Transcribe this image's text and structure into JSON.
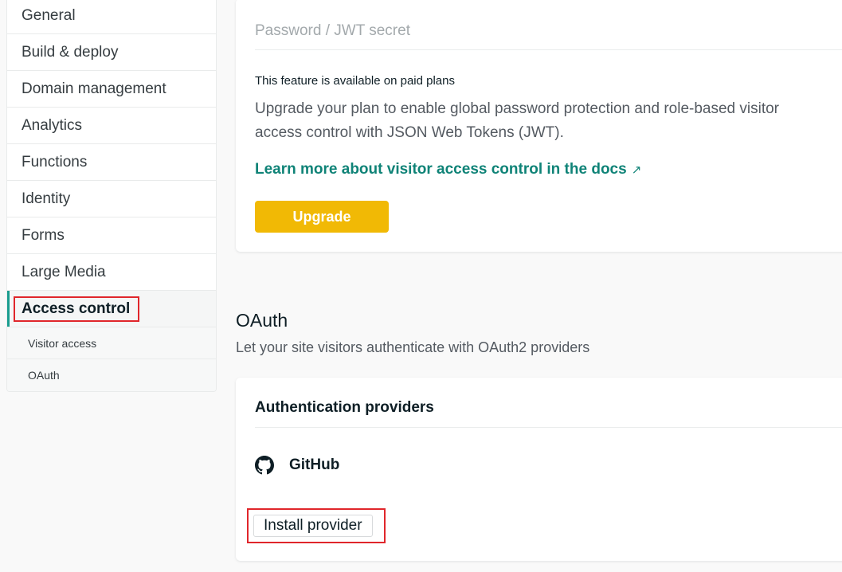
{
  "sidebar": {
    "items": [
      {
        "label": "General"
      },
      {
        "label": "Build & deploy"
      },
      {
        "label": "Domain management"
      },
      {
        "label": "Analytics"
      },
      {
        "label": "Functions"
      },
      {
        "label": "Identity"
      },
      {
        "label": "Forms"
      },
      {
        "label": "Large Media"
      },
      {
        "label": "Access control"
      }
    ],
    "subitems": [
      {
        "label": "Visitor access"
      },
      {
        "label": "OAuth"
      }
    ]
  },
  "password_card": {
    "title": "Password / JWT secret",
    "feature_note": "This feature is available on paid plans",
    "description": "Upgrade your plan to enable global password protection and role-based visitor access control with JSON Web Tokens (JWT).",
    "docs_link": "Learn more about visitor access control in the docs",
    "docs_icon": "↗",
    "upgrade_label": "Upgrade",
    "upgrade_color": "#f1b905",
    "link_color": "#0f8377"
  },
  "oauth": {
    "title": "OAuth",
    "description": "Let your site visitors authenticate with OAuth2 providers",
    "card_title": "Authentication providers",
    "provider": {
      "name": "GitHub",
      "icon": "github-icon"
    },
    "install_label": "Install provider"
  }
}
